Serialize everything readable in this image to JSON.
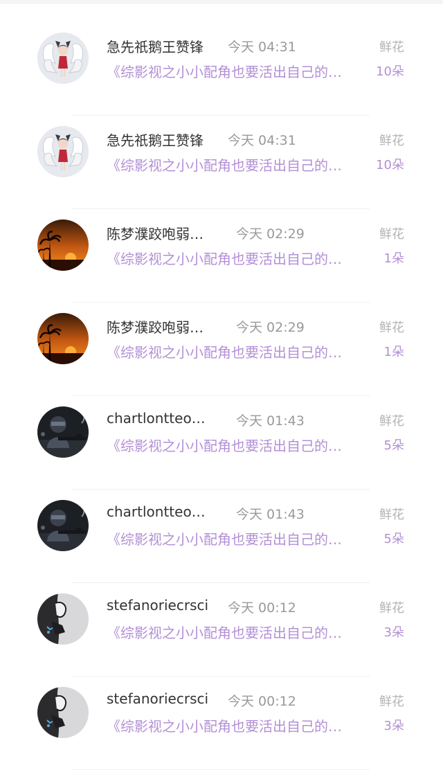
{
  "rows": [
    {
      "name": "急先祇鹅王赞锋",
      "time": "今天 04:31",
      "flower_label": "鲜花",
      "book": "《综影视之小小配角也要活出自己的…",
      "count": "10朵",
      "avatar": "fox-spirit"
    },
    {
      "name": "急先祇鹅王赞锋",
      "time": "今天 04:31",
      "flower_label": "鲜花",
      "book": "《综影视之小小配角也要活出自己的…",
      "count": "10朵",
      "avatar": "fox-spirit"
    },
    {
      "name": "陈梦濮跤咆弱…",
      "time": "今天 02:29",
      "flower_label": "鲜花",
      "book": "《综影视之小小配角也要活出自己的…",
      "count": "1朵",
      "avatar": "sunset-palm"
    },
    {
      "name": "陈梦濮跤咆弱…",
      "time": "今天 02:29",
      "flower_label": "鲜花",
      "book": "《综影视之小小配角也要活出自己的…",
      "count": "1朵",
      "avatar": "sunset-palm"
    },
    {
      "name": "chartlontteo…",
      "time": "今天 01:43",
      "flower_label": "鲜花",
      "book": "《综影视之小小配角也要活出自己的…",
      "count": "5朵",
      "avatar": "soldier"
    },
    {
      "name": "chartlontteo…",
      "time": "今天 01:43",
      "flower_label": "鲜花",
      "book": "《综影视之小小配角也要活出自己的…",
      "count": "5朵",
      "avatar": "soldier"
    },
    {
      "name": "stefanoriecrsci",
      "time": "今天 00:12",
      "flower_label": "鲜花",
      "book": "《综影视之小小配角也要活出自己的…",
      "count": "3朵",
      "avatar": "sketch-figure"
    },
    {
      "name": "stefanoriecrsci",
      "time": "今天 00:12",
      "flower_label": "鲜花",
      "book": "《综影视之小小配角也要活出自己的…",
      "count": "3朵",
      "avatar": "sketch-figure"
    }
  ]
}
